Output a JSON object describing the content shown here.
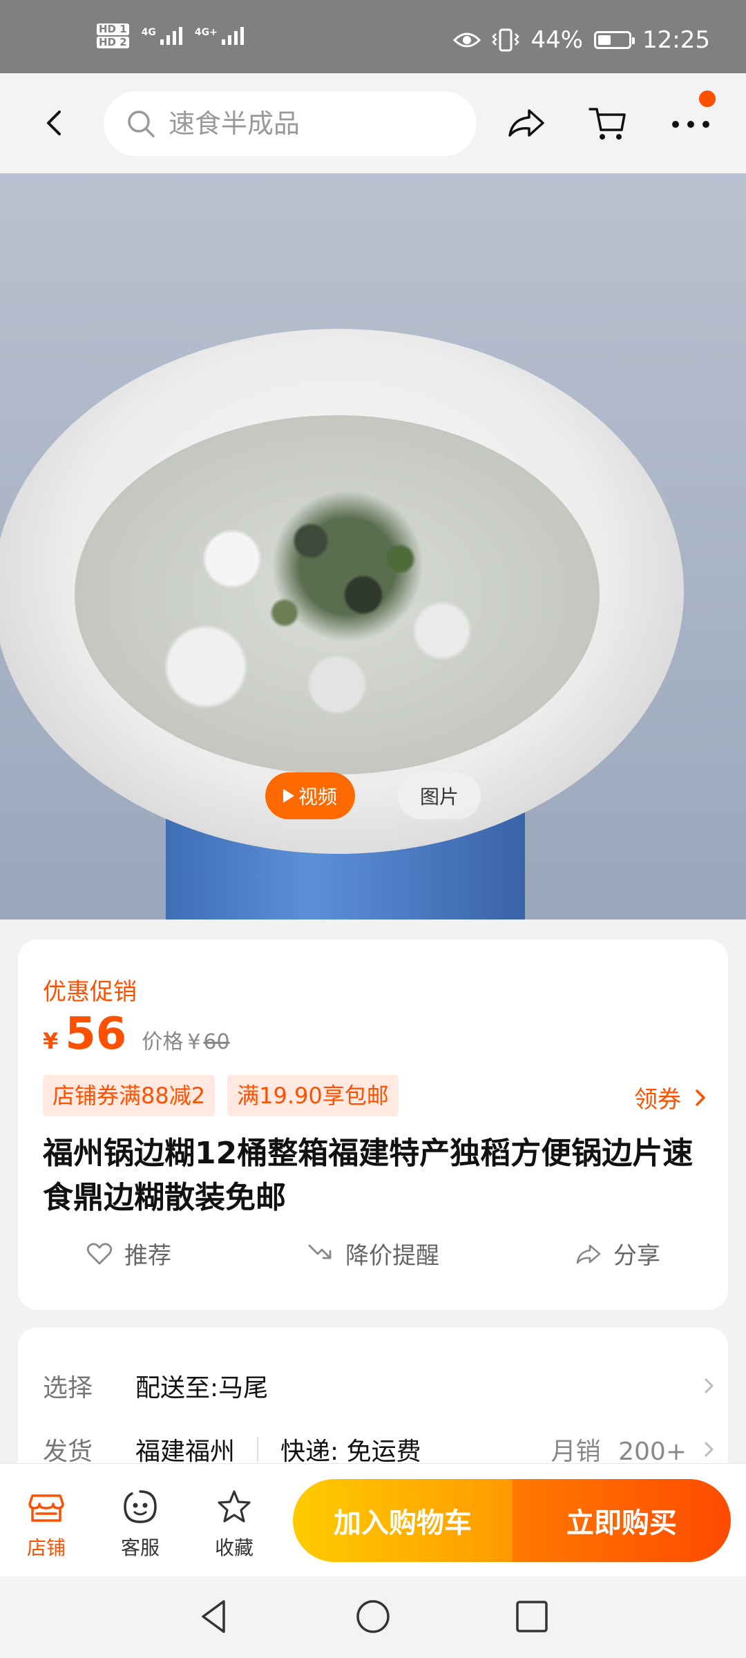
{
  "status_bar": {
    "hd1": "HD 1",
    "hd2": "HD 2",
    "net1": "4G",
    "net2": "4G+",
    "battery_percent": "44%",
    "battery_level": 0.44,
    "time": "12:25"
  },
  "top_nav": {
    "search_placeholder": "速食半成品",
    "notification_dot_color": "#ff5000"
  },
  "media": {
    "video_label": "视频",
    "photo_label": "图片"
  },
  "product": {
    "promo_label": "优惠促销",
    "currency": "¥",
    "price": "56",
    "original_price_label": "价格",
    "original_currency": "¥",
    "original_price": "60",
    "coupons": [
      "店铺券满88减2",
      "满19.90享包邮"
    ],
    "get_coupon": "领券",
    "title": "福州锅边糊12桶整箱福建特产独稻方便锅边片速食鼎边糊散装免邮",
    "actions": {
      "recommend": "推荐",
      "price_alert": "降价提醒",
      "share": "分享"
    }
  },
  "delivery": {
    "select_label": "选择",
    "select_value": "配送至:马尾",
    "ship_label": "发货",
    "ship_from": "福建福州",
    "express": "快递: 免运费",
    "monthly_sales_label": "月销",
    "monthly_sales": "200+"
  },
  "bottom_bar": {
    "shop": "店铺",
    "service": "客服",
    "favorite": "收藏",
    "add_to_cart": "加入购物车",
    "buy_now": "立即购买"
  },
  "colors": {
    "accent": "#ff5000",
    "cart_button": "#ffb300",
    "buy_button": "#ff5a00"
  }
}
